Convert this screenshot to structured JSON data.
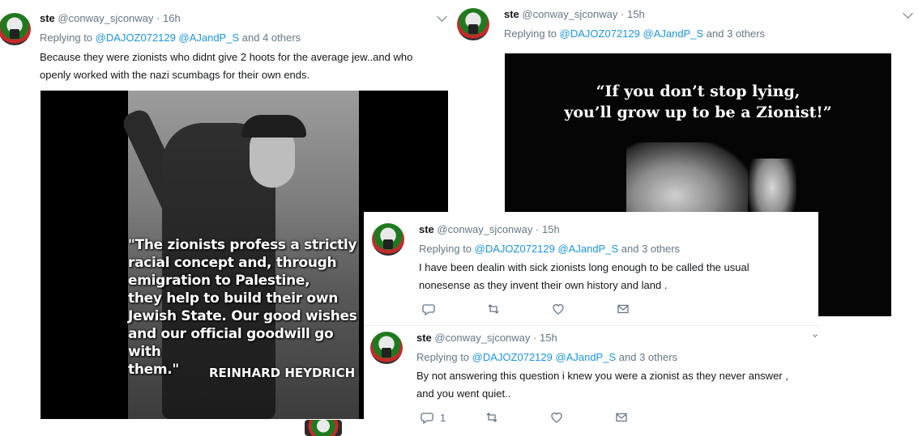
{
  "tweet1": {
    "name": "ste",
    "handle": "@conway_sjconway",
    "dot": "·",
    "time": "16h",
    "replying_prefix": "Replying to",
    "mention1": "@DAJOZ072129",
    "mention2": "@AJandP_S",
    "others": "and 4 others",
    "text_line1": "Because they were zionists who didnt give 2 hoots for the average jew..and who",
    "text_line2": "openly worked with the nazi scumbags for their own ends.",
    "image": {
      "quote_line1": "\"The zionists profess a strictly",
      "quote_line2": "racial concept and, through",
      "quote_line3": "emigration to Palestine,",
      "quote_line4": "they help to build their own",
      "quote_line5": "Jewish State. Our good wishes",
      "quote_line6": "and our official goodwill go with",
      "quote_line7": "them.\"",
      "credit": "REINHARD HEYDRICH"
    }
  },
  "tweet2": {
    "name": "ste",
    "handle": "@conway_sjconway",
    "dot": "·",
    "time": "15h",
    "replying_prefix": "Replying to",
    "mention1": "@DAJOZ072129",
    "mention2": "@AJandP_S",
    "others": "and 3 others",
    "image": {
      "caption_line1": "“If you don’t stop lying,",
      "caption_line2": "you’ll grow up to be a Zionist!”"
    }
  },
  "tweet3": {
    "name": "ste",
    "handle": "@conway_sjconway",
    "dot": "·",
    "time": "15h",
    "replying_prefix": "Replying to",
    "mention1": "@DAJOZ072129",
    "mention2": "@AJandP_S",
    "others": "and 3 others",
    "text_line1": "I have been dealin with sick zionists long enough to be called the usual",
    "text_line2": "nonesense as they invent their own history and land ."
  },
  "tweet4": {
    "name": "ste",
    "handle": "@conway_sjconway",
    "dot": "·",
    "time": "15h",
    "replying_prefix": "Replying to",
    "mention1": "@DAJOZ072129",
    "mention2": "@AJandP_S",
    "others": "and 3 others",
    "text_line1": "By not answering this question i knew you were a zionist as they never answer ,",
    "text_line2": "and you went quiet..",
    "reply_count": "1"
  },
  "colors": {
    "link": "#1b95e0",
    "muted": "#657786",
    "text": "#14171a"
  },
  "icons": [
    "chevron-down-icon",
    "reply-icon",
    "retweet-icon",
    "like-icon",
    "dm-icon"
  ]
}
